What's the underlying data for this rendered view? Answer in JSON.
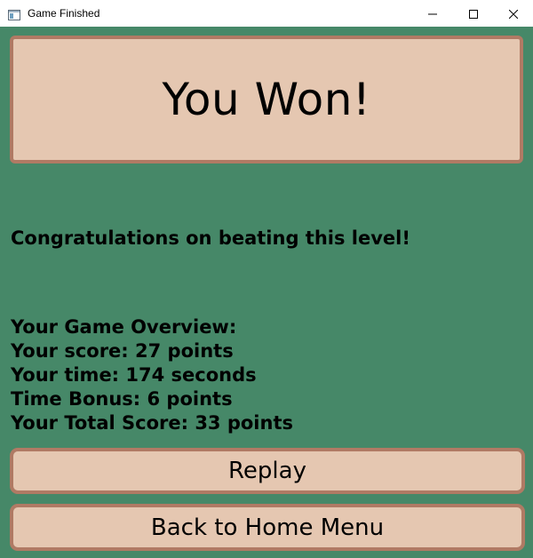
{
  "window": {
    "title": "Game Finished",
    "app_icon": "window-app-icon",
    "controls": {
      "minimize_icon": "minimize-icon",
      "maximize_icon": "maximize-icon",
      "close_icon": "close-icon"
    }
  },
  "colors": {
    "background": "#468868",
    "panel_fill": "#e5c7b1",
    "panel_border": "#b07a64",
    "text": "#000000"
  },
  "banner": {
    "text": "You Won!"
  },
  "message": "Congratulations on beating this level!",
  "overview": {
    "heading": "Your Game Overview:",
    "score": "Your score: 27 points",
    "time": "Your time: 174 seconds",
    "time_bonus": "Time Bonus: 6 points",
    "total": "Your Total Score: 33 points"
  },
  "buttons": {
    "replay": "Replay",
    "home": "Back to Home Menu"
  }
}
